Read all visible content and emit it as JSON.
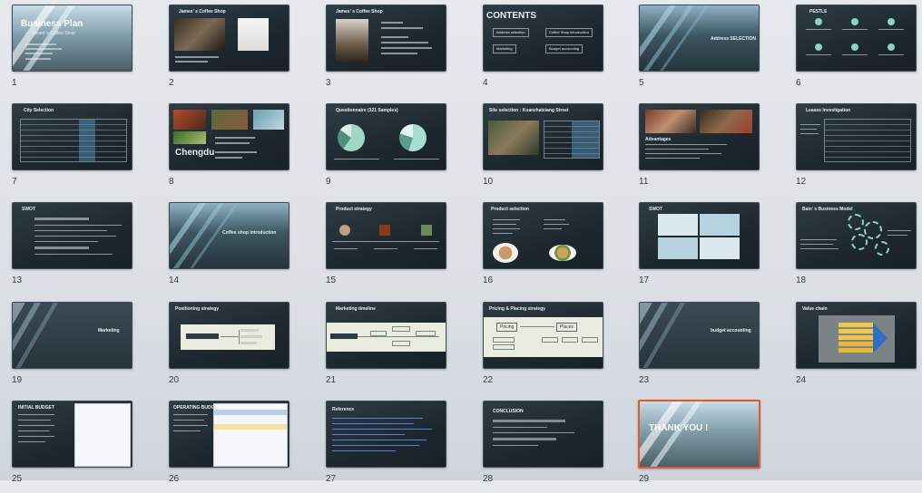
{
  "slides": [
    {
      "num": "1",
      "title": "Business Plan",
      "subtitle": "— James’ s Coffee Shop"
    },
    {
      "num": "2",
      "title": "James’ s Coffee Shop"
    },
    {
      "num": "3",
      "title": "James’ s Coffee Shop"
    },
    {
      "num": "4",
      "title": "CONTENTS",
      "items": [
        "Address selection",
        "Coffee Shop introduction",
        "Marketing",
        "Budget accounting"
      ]
    },
    {
      "num": "5",
      "title": "Address SELECTION"
    },
    {
      "num": "6",
      "title": "PESTLE"
    },
    {
      "num": "7",
      "title": "City Selection"
    },
    {
      "num": "8",
      "title": "Chengdu"
    },
    {
      "num": "9",
      "title": "Questionnaire (321 Samples)"
    },
    {
      "num": "10",
      "title": "Site selection : Kuanzhaixiang Street"
    },
    {
      "num": "11",
      "title": "Advantages"
    },
    {
      "num": "12",
      "title": "Leases Investigation"
    },
    {
      "num": "13",
      "title": "SWOT"
    },
    {
      "num": "14",
      "title": "Coffee shop introduction"
    },
    {
      "num": "15",
      "title": "Product strategy"
    },
    {
      "num": "16",
      "title": "Product selection"
    },
    {
      "num": "17",
      "title": "SWOT"
    },
    {
      "num": "18",
      "title": "Bain’ s Business Model"
    },
    {
      "num": "19",
      "title": "Marketing"
    },
    {
      "num": "20",
      "title": "Positioning strategy"
    },
    {
      "num": "21",
      "title": "Marketing timeline"
    },
    {
      "num": "22",
      "title": "Pricing & Placing strategy",
      "boxes": [
        "Pricing",
        "Places"
      ]
    },
    {
      "num": "23",
      "title": "budget accounting"
    },
    {
      "num": "24",
      "title": "Value chain"
    },
    {
      "num": "25",
      "title": "INITIAL BUDGET"
    },
    {
      "num": "26",
      "title": "OPERATING BUDGET"
    },
    {
      "num": "27",
      "title": "Reference"
    },
    {
      "num": "28",
      "title": "CONCLUSION"
    },
    {
      "num": "29",
      "title": "THANK YOU !"
    }
  ]
}
